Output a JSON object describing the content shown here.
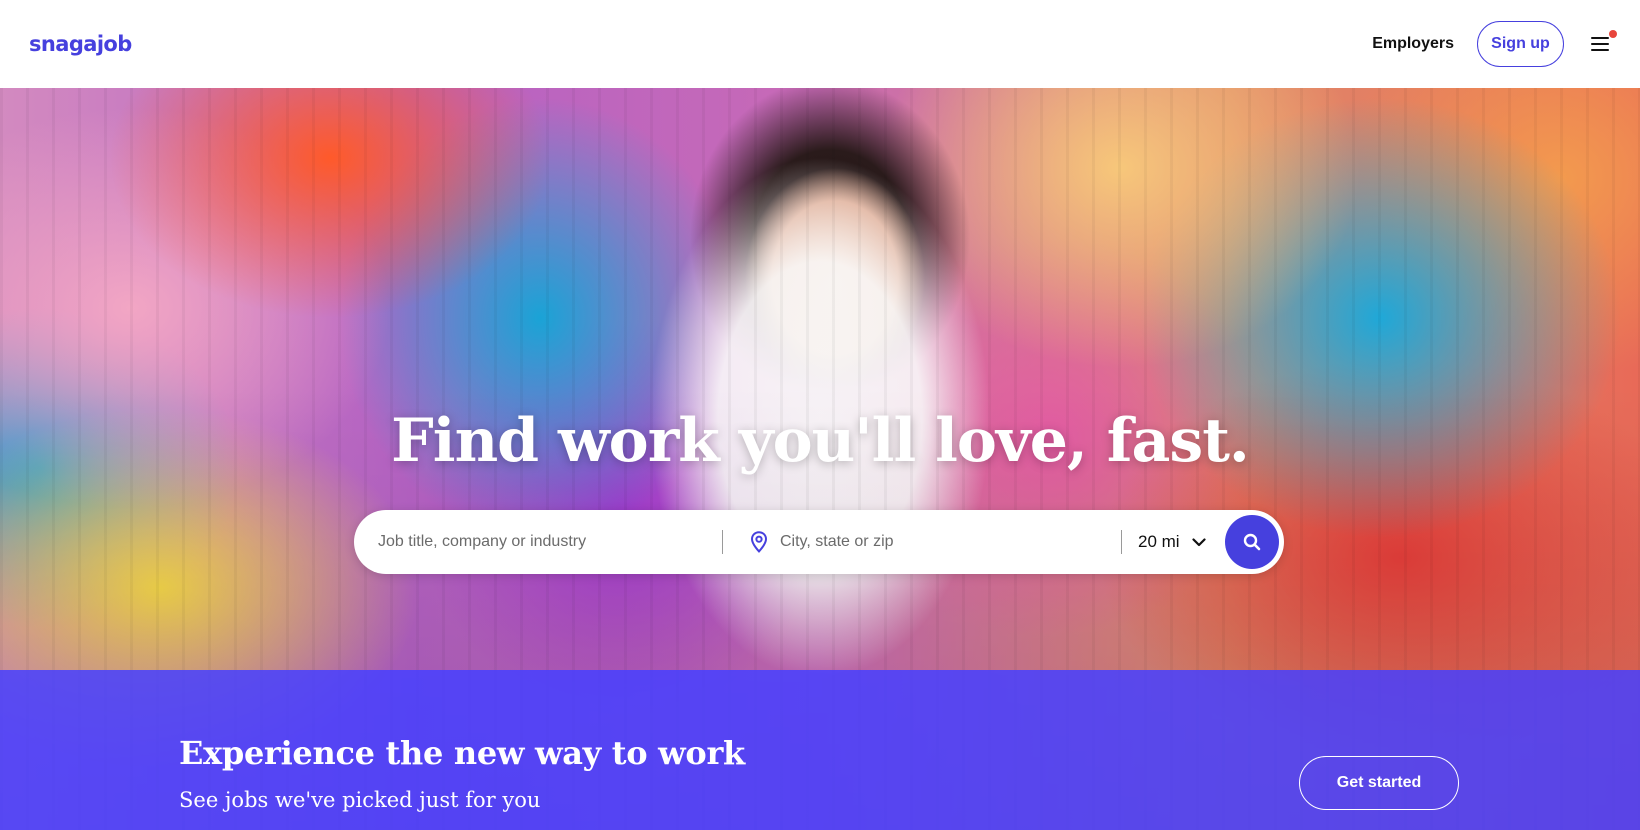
{
  "header": {
    "logo": "snagajob",
    "employers_link": "Employers",
    "signup_label": "Sign up",
    "menu_icon": "hamburger-menu-icon",
    "notification_dot_color": "#e8453c"
  },
  "hero": {
    "title": "Find work you'll love, fast.",
    "search": {
      "job_placeholder": "Job title, company or industry",
      "job_value": "",
      "location_placeholder": "City, state or zip",
      "location_value": "",
      "location_icon": "map-pin-icon",
      "radius": "20 mi",
      "radius_icon": "chevron-down-icon",
      "search_icon": "magnifier-icon"
    }
  },
  "promo": {
    "title": "Experience the new way to work",
    "subtitle": "See jobs we've picked just for you",
    "cta": "Get started"
  },
  "colors": {
    "brand": "#4640de",
    "promo_band": "#4740ff",
    "text": "#111111"
  }
}
